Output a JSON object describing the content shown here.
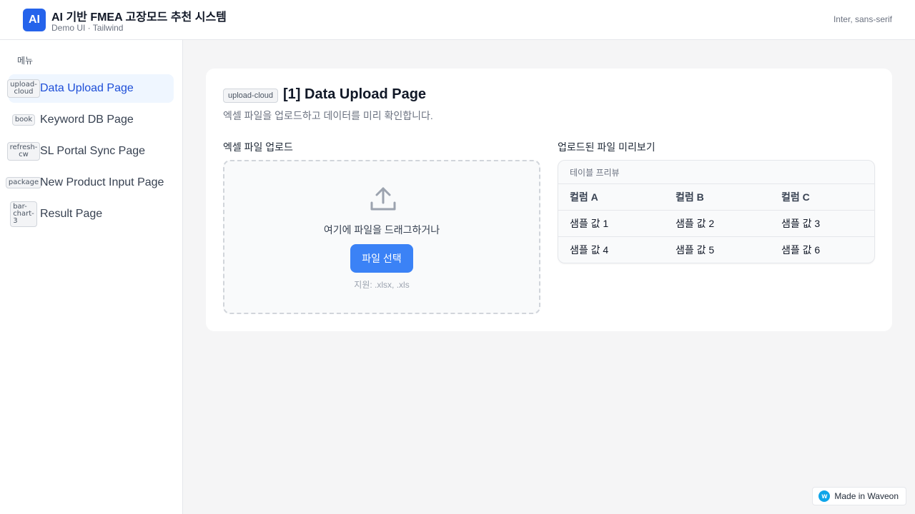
{
  "header": {
    "logo_text": "AI",
    "title": "AI 기반 FMEA 고장모드 추천 시스템",
    "subtitle": "Demo UI · Tailwind",
    "font_note": "Inter, sans-serif"
  },
  "sidebar": {
    "menu_label": "메뉴",
    "items": [
      {
        "icon": "upload-\ncloud",
        "label": "Data Upload Page"
      },
      {
        "icon": "book",
        "label": "Keyword DB Page"
      },
      {
        "icon": "refresh-\ncw",
        "label": "SL Portal Sync Page"
      },
      {
        "icon": "package",
        "label": "New Product Input Page"
      },
      {
        "icon": "bar-\nchart-\n3",
        "label": "Result Page"
      }
    ]
  },
  "page": {
    "icon": "upload-cloud",
    "title": "[1] Data Upload Page",
    "description": "엑셀 파일을 업로드하고 데이터를 미리 확인합니다."
  },
  "upload": {
    "section_label": "엑셀 파일 업로드",
    "drop_text": "여기에 파일을 드래그하거나",
    "button_label": "파일 선택",
    "support_text": "지원: .xlsx, .xls"
  },
  "preview": {
    "section_label": "업로드된 파일 미리보기",
    "caption": "테이블 프리뷰",
    "columns": [
      "컬럼 A",
      "컬럼 B",
      "컬럼 C"
    ],
    "rows": [
      [
        "샘플 값 1",
        "샘플 값 2",
        "샘플 값 3"
      ],
      [
        "샘플 값 4",
        "샘플 값 5",
        "샘플 값 6"
      ]
    ]
  },
  "badge": {
    "logo_text": "w",
    "label": "Made in Waveon"
  },
  "colors": {
    "accent": "#3b82f6",
    "brand": "#2563eb",
    "active_bg": "#eff6ff"
  }
}
